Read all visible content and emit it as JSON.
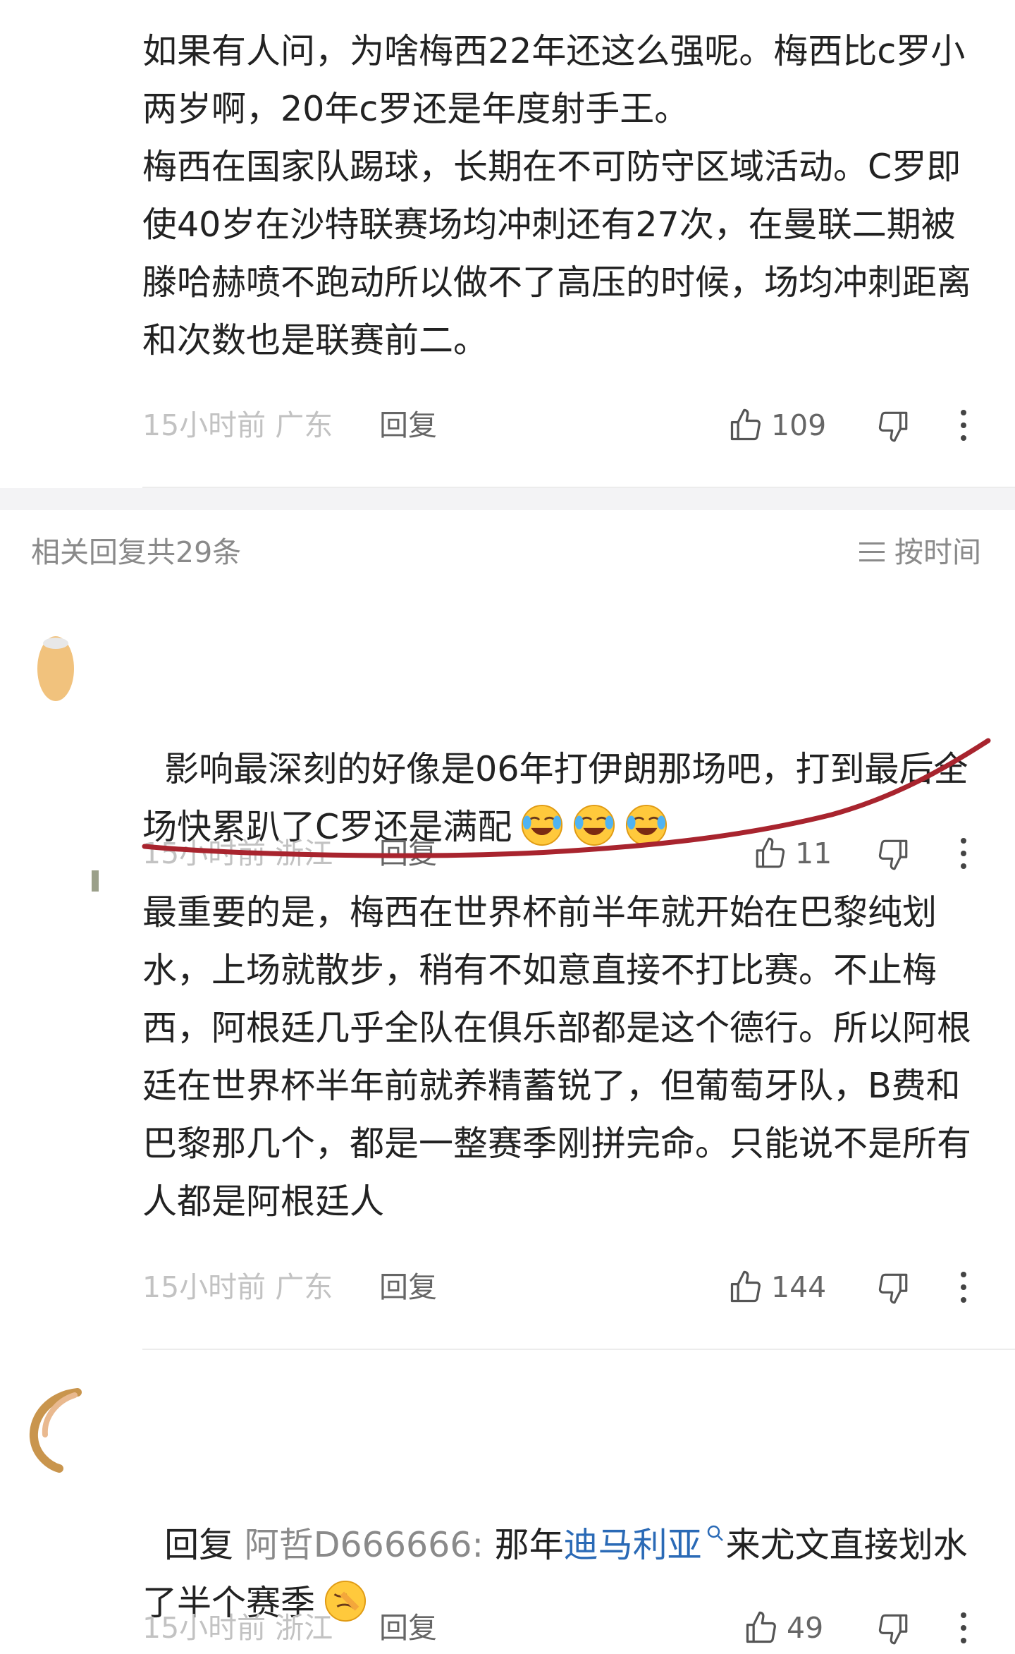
{
  "comments": [
    {
      "text": "如果有人问，为啥梅西22年还这么强呢。梅西比c罗小两岁啊，20年c罗还是年度射手王。\n梅西在国家队踢球，长期在不可防守区域活动。C罗即使40岁在沙特联赛场均冲刺还有27次，在曼联二期被滕哈赫喷不跑动所以做不了高压的时候，场均冲刺距离和次数也是联赛前二。",
      "time_location": "15小时前 广东",
      "reply_label": "回复",
      "likes": "109"
    }
  ],
  "replies_header": {
    "title": "相关回复共29条",
    "sort_label": "按时间"
  },
  "replies": [
    {
      "text": "影响最深刻的好像是06年打伊朗那场吧，打到最后全场快累趴了C罗还是满配",
      "emoji_icon": "crying-laughing-emoji",
      "emoji_count": 3,
      "time_location": "15小时前 浙江",
      "reply_label": "回复",
      "likes": "11"
    },
    {
      "text": "最重要的是，梅西在世界杯前半年就开始在巴黎纯划水，上场就散步，稍有不如意直接不打比赛。不止梅西，阿根廷几乎全队在俱乐部都是这个德行。所以阿根廷在世界杯半年前就养精蓄锐了，但葡萄牙队，B费和巴黎那几个，都是一整赛季刚拼完命。只能说不是所有人都是阿根廷人",
      "time_location": "15小时前 广东",
      "reply_label": "回复",
      "likes": "144"
    },
    {
      "reply_prefix": "回复",
      "mention": "阿哲D666666:",
      "text_before": "那年",
      "link_text": "迪马利亚",
      "text_after": "来尤文直接划水了半个赛季",
      "emoji_icon": "facepalm-emoji",
      "time_location": "15小时前 浙江",
      "reply_label": "回复",
      "likes": "49"
    }
  ],
  "colors": {
    "annotation": "#a8242e",
    "link": "#2a6ab6",
    "meta_gray": "#c2c2c2"
  }
}
